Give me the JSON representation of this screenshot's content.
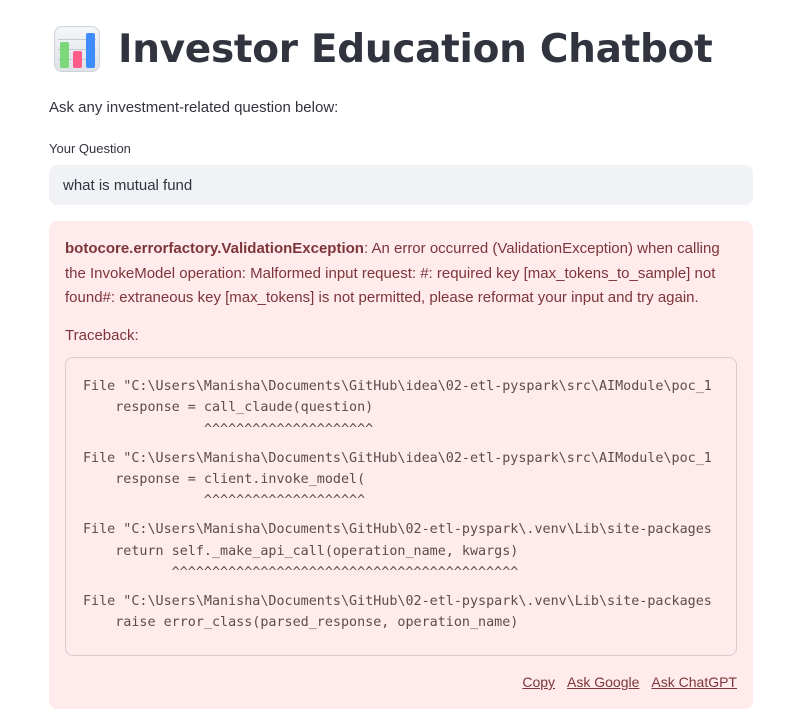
{
  "header": {
    "title": "Investor Education Chatbot",
    "icon": "bar-chart-icon",
    "icon_bar_colors": [
      "#7cd87a",
      "#ff5c8a",
      "#3f8cff"
    ]
  },
  "intro": {
    "text": "Ask any investment-related question below:"
  },
  "question": {
    "label": "Your Question",
    "value": "what is mutual fund"
  },
  "error": {
    "type": "botocore.errorfactory.ValidationException",
    "message": ": An error occurred (ValidationException) when calling the InvokeModel operation: Malformed input request: #: required key [max_tokens_to_sample] not found#: extraneous key [max_tokens] is not permitted, please reformat your input and try again.",
    "traceback_label": "Traceback:",
    "traceback_lines": [
      "File \"C:\\Users\\Manisha\\Documents\\GitHub\\idea\\02-etl-pyspark\\src\\AIModule\\poc_1",
      "    response = call_claude(question)",
      "               ^^^^^^^^^^^^^^^^^^^^^",
      "",
      "File \"C:\\Users\\Manisha\\Documents\\GitHub\\idea\\02-etl-pyspark\\src\\AIModule\\poc_1",
      "    response = client.invoke_model(",
      "               ^^^^^^^^^^^^^^^^^^^^",
      "",
      "File \"C:\\Users\\Manisha\\Documents\\GitHub\\02-etl-pyspark\\.venv\\Lib\\site-packages",
      "    return self._make_api_call(operation_name, kwargs)",
      "           ^^^^^^^^^^^^^^^^^^^^^^^^^^^^^^^^^^^^^^^^^^^",
      "",
      "File \"C:\\Users\\Manisha\\Documents\\GitHub\\02-etl-pyspark\\.venv\\Lib\\site-packages",
      "    raise error_class(parsed_response, operation_name)"
    ],
    "actions": {
      "copy": "Copy",
      "ask_google": "Ask Google",
      "ask_chatgpt": "Ask ChatGPT"
    },
    "colors": {
      "background": "#ffebec",
      "text": "#7d353b"
    }
  }
}
